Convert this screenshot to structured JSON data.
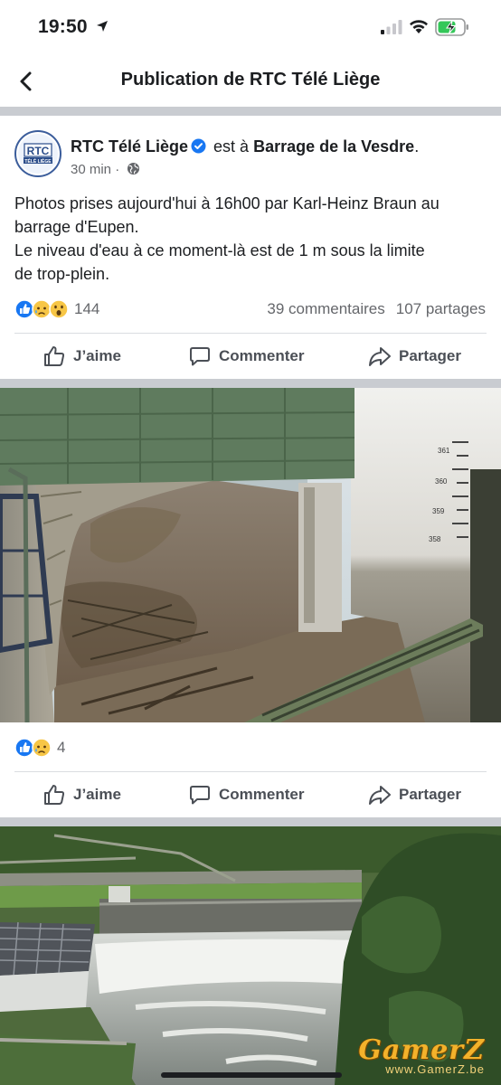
{
  "status_bar": {
    "time": "19:50"
  },
  "header": {
    "title": "Publication de RTC Télé Liège"
  },
  "post": {
    "author": "RTC Télé Liège",
    "avatar_text_top": "RTC",
    "avatar_text_bottom": "TÉLÉ LIÈGE",
    "location_prefix": "est à",
    "location": "Barrage de la Vesdre",
    "location_suffix": ".",
    "time_ago": "30 min",
    "privacy_separator": "·",
    "text_lines": [
      "Photos prises aujourd'hui à 16h00 par Karl-Heinz Braun au",
      "barrage d'Eupen.",
      "Le niveau d'eau à ce moment-là est de 1 m sous la limite",
      "de trop-plein."
    ],
    "reactions_count": "144",
    "comments": "39 commentaires",
    "shares": "107 partages"
  },
  "actions": {
    "like": "J’aime",
    "comment": "Commenter",
    "share": "Partager"
  },
  "photo1": {
    "reactions_count": "4",
    "gauge_labels": [
      "361",
      "360",
      "359",
      "358"
    ]
  },
  "watermark": {
    "main": "GamerZ",
    "sub": "www.GamerZ.be"
  },
  "colors": {
    "like_blue": "#1877f2",
    "reaction_yellow": "#f7c646",
    "text_secondary": "#65676b",
    "separator": "#c9ccd1"
  }
}
